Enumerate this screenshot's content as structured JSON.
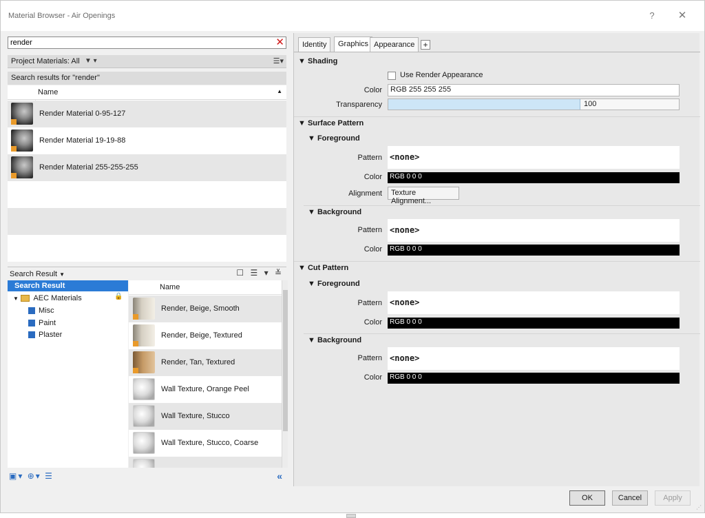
{
  "window": {
    "title": "Material Browser - Air Openings",
    "help_label": "?",
    "close_label": "✕"
  },
  "search": {
    "value": "render",
    "clear_label": "✕"
  },
  "project_bar": {
    "label": "Project Materials: All",
    "filter_icon": "filter-icon",
    "view_icon": "list-view-icon"
  },
  "results_label": "Search results for \"render\"",
  "material_table": {
    "header": "Name",
    "sort_indicator": "▲",
    "rows": [
      "Render Material 0-95-127",
      "Render Material 19-19-88",
      "Render Material 255-255-255"
    ]
  },
  "library_bar": {
    "crumb": "Search Result",
    "crumb_arrow": "▼",
    "icons": "☐ ☰ ▾ ≚"
  },
  "tree": {
    "header": "Search Result",
    "root": "AEC Materials",
    "children": [
      "Misc",
      "Paint",
      "Plaster"
    ],
    "lock_glyph": "🔒"
  },
  "library_table": {
    "header": "Name",
    "rows": [
      {
        "name": "Render, Beige, Smooth",
        "thumb": "beige"
      },
      {
        "name": "Render, Beige, Textured",
        "thumb": "beige"
      },
      {
        "name": "Render, Tan, Textured",
        "thumb": "tan"
      },
      {
        "name": "Wall Texture, Orange Peel",
        "thumb": "sphere"
      },
      {
        "name": "Wall Texture, Stucco",
        "thumb": "sphere"
      },
      {
        "name": "Wall Texture, Stucco, Coarse",
        "thumb": "sphere"
      }
    ]
  },
  "bottom_tools": {
    "icons": "▣▾ ⊕▾ ☰",
    "collapse": "«"
  },
  "tabs": [
    {
      "label": "Identity",
      "active": false
    },
    {
      "label": "Graphics",
      "active": true
    },
    {
      "label": "Appearance",
      "active": false
    }
  ],
  "tab_add_label": "+",
  "shading": {
    "title": "▼ Shading",
    "use_render_label": "Use Render Appearance",
    "use_render_checked": false,
    "color_label": "Color",
    "color_value": "RGB 255 255 255",
    "transparency_label": "Transparency",
    "transparency_value": "100",
    "transparency_fraction": 0.66
  },
  "surface_pattern": {
    "title": "▼ Surface Pattern",
    "foreground": {
      "title": "▼ Foreground",
      "pattern_label": "Pattern",
      "pattern_value": "<none>",
      "color_label": "Color",
      "color_value": "RGB 0 0 0",
      "alignment_label": "Alignment",
      "alignment_button": "Texture Alignment..."
    },
    "background": {
      "title": "▼ Background",
      "pattern_label": "Pattern",
      "pattern_value": "<none>",
      "color_label": "Color",
      "color_value": "RGB 0 0 0"
    }
  },
  "cut_pattern": {
    "title": "▼ Cut Pattern",
    "foreground": {
      "title": "▼ Foreground",
      "pattern_label": "Pattern",
      "pattern_value": "<none>",
      "color_label": "Color",
      "color_value": "RGB 0 0 0"
    },
    "background": {
      "title": "▼ Background",
      "pattern_label": "Pattern",
      "pattern_value": "<none>",
      "color_label": "Color",
      "color_value": "RGB 0 0 0"
    }
  },
  "footer": {
    "ok": "OK",
    "cancel": "Cancel",
    "apply": "Apply"
  }
}
